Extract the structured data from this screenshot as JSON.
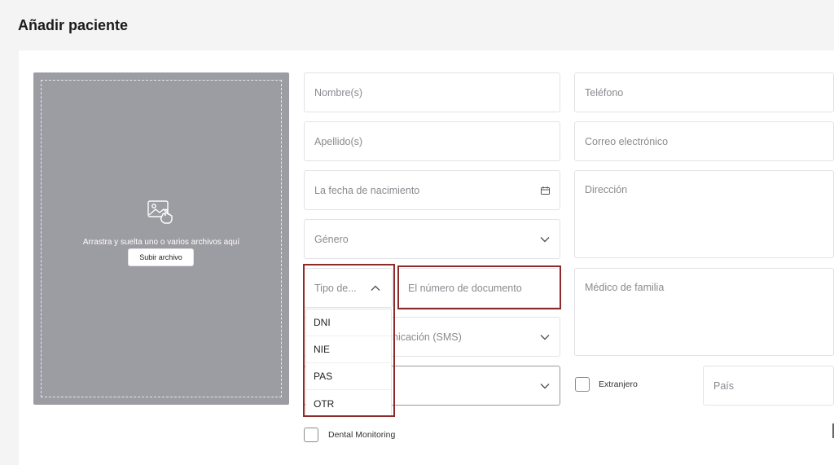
{
  "page": {
    "title": "Añadir paciente"
  },
  "upload": {
    "icon": "image-upload-icon",
    "text": "Arrastra y suelta uno o varios archivos aquí",
    "button_label": "Subir archivo"
  },
  "form": {
    "nombre": {
      "placeholder": "Nombre(s)"
    },
    "apellido": {
      "placeholder": "Apellido(s)"
    },
    "fecha": {
      "placeholder": "La fecha de nacimiento",
      "icon": "calendar-icon"
    },
    "genero": {
      "placeholder": "Género",
      "icon": "chevron-down-icon"
    },
    "tipo_doc": {
      "placeholder": "Tipo de...",
      "icon": "chevron-up-icon"
    },
    "numero_doc": {
      "placeholder": "El número de documento"
    },
    "comunicacion": {
      "placeholder": "nicación (SMS)",
      "icon": "chevron-down-icon"
    },
    "extra_select": {
      "icon": "chevron-down-icon"
    },
    "telefono": {
      "placeholder": "Teléfono"
    },
    "correo": {
      "placeholder": "Correo electrónico"
    },
    "direccion": {
      "placeholder": "Dirección"
    },
    "medico": {
      "placeholder": "Médico de familia"
    },
    "extranjero": {
      "label": "Extranjero"
    },
    "pais": {
      "placeholder": "País"
    },
    "dental": {
      "label": "Dental Monitoring"
    }
  },
  "dropdown": {
    "options": [
      "DNI",
      "NIE",
      "PAS",
      "OTR"
    ]
  },
  "colors": {
    "highlight": "#8e2a2a",
    "upload_bg": "#9c9ca3",
    "page_bg": "#f4f4f5"
  }
}
